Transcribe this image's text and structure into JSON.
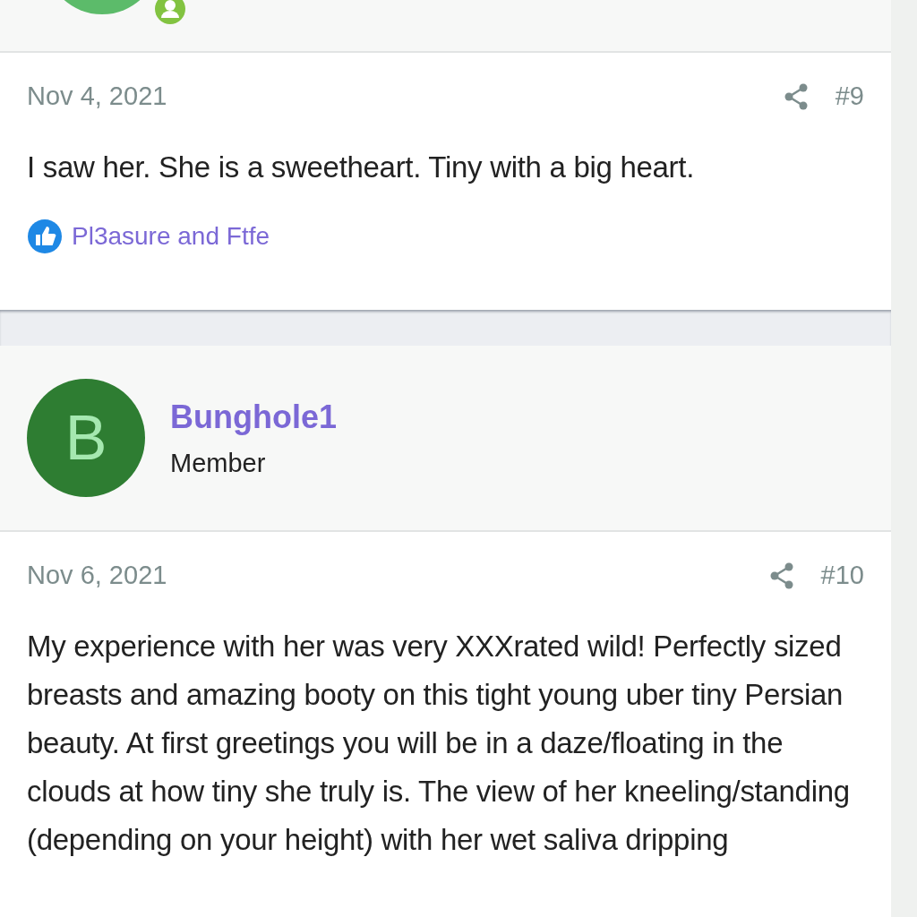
{
  "posts": [
    {
      "kind": "cut"
    },
    {
      "kind": "full",
      "author": {
        "initial": "B",
        "name": "Bunghole1",
        "title": "Member",
        "color": "#2e7d32"
      },
      "date": "Nov 6, 2021",
      "number": "#10",
      "body": "My experience with her was very XXXrated wild! Perfectly sized breasts and amazing booty on this tight young uber tiny Persian beauty. At first greetings you will be in a daze/floating in the clouds at how tiny she truly is. The view of her kneeling/standing (depending on your height) with her wet saliva dripping"
    }
  ],
  "first_post": {
    "date": "Nov 4, 2021",
    "number": "#9",
    "body": "I saw her. She is a sweetheart. Tiny with a big heart.",
    "reactions": "Pl3asure and Ftfe"
  }
}
